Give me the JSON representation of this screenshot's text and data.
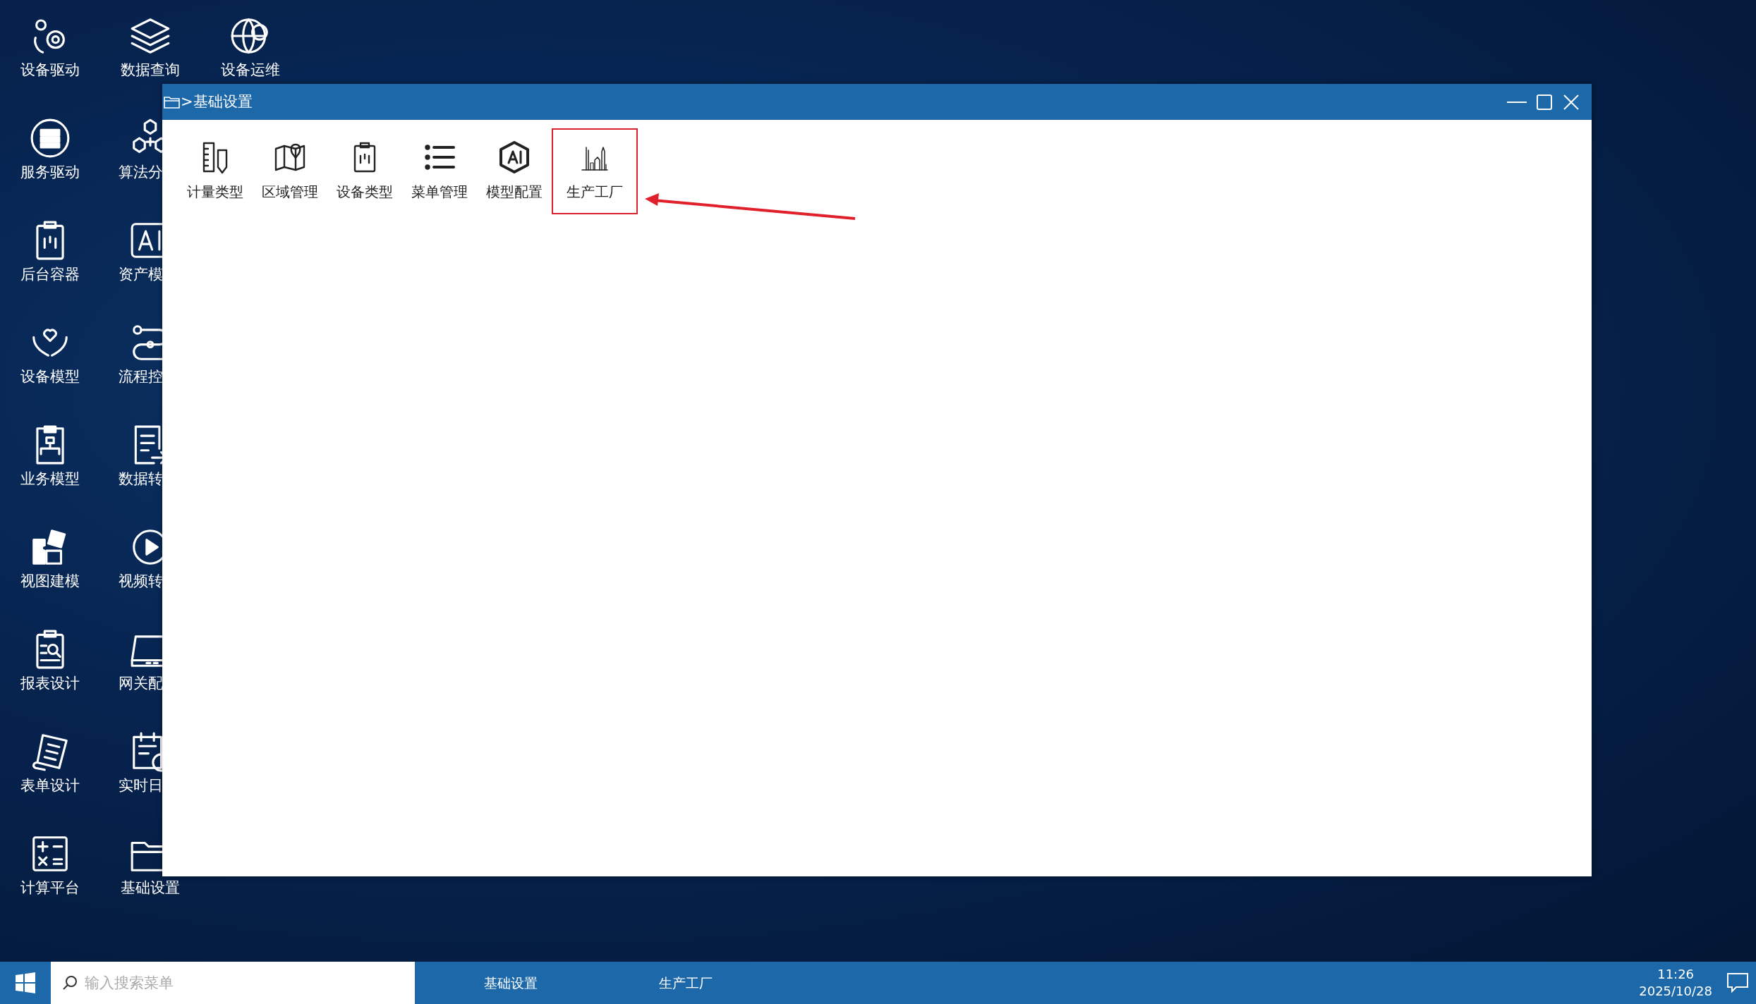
{
  "desktop_icons": [
    {
      "label": "设备驱动"
    },
    {
      "label": "服务驱动"
    },
    {
      "label": "后台容器"
    },
    {
      "label": "设备模型"
    },
    {
      "label": "业务模型"
    },
    {
      "label": "视图建模"
    },
    {
      "label": "报表设计"
    },
    {
      "label": "表单设计"
    },
    {
      "label": "计算平台"
    },
    {
      "label": "数据查询"
    },
    {
      "label": "算法分"
    },
    {
      "label": "资产模"
    },
    {
      "label": "流程控"
    },
    {
      "label": "数据转"
    },
    {
      "label": "视频转"
    },
    {
      "label": "网关配"
    },
    {
      "label": "实时日"
    },
    {
      "label": "基础设置"
    },
    {
      "label": "设备运维"
    }
  ],
  "window": {
    "title": ">基础设置",
    "tools": [
      {
        "label": "计量类型",
        "highlighted": false
      },
      {
        "label": "区域管理",
        "highlighted": false
      },
      {
        "label": "设备类型",
        "highlighted": false
      },
      {
        "label": "菜单管理",
        "highlighted": false
      },
      {
        "label": "模型配置",
        "highlighted": false
      },
      {
        "label": "生产工厂",
        "highlighted": true
      }
    ]
  },
  "taskbar": {
    "search": {
      "placeholder": "输入搜索菜单"
    },
    "tasks": [
      {
        "label": "基础设置"
      },
      {
        "label": "生产工厂"
      }
    ],
    "time": "11:26",
    "date": "2025/10/28"
  }
}
